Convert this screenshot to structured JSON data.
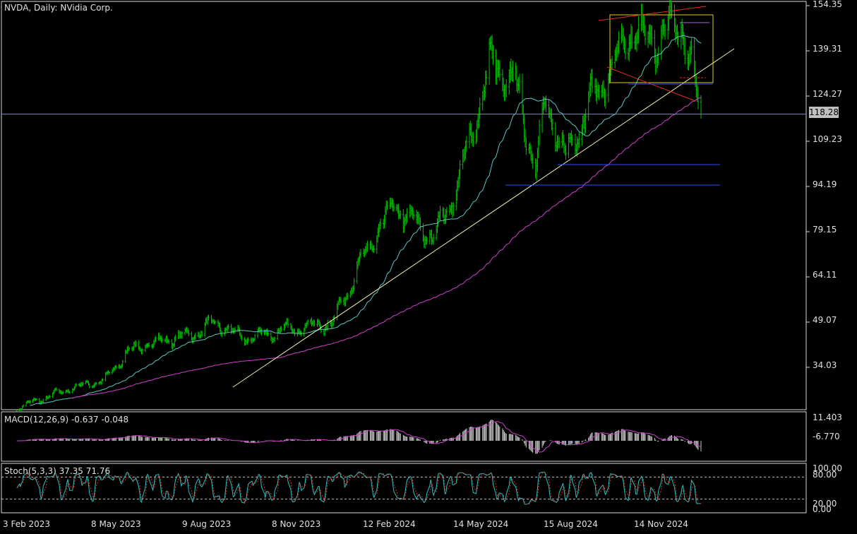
{
  "header": {
    "title": "NVDA, Daily:  NVidia Corp."
  },
  "colors": {
    "background": "#000000",
    "grid": "#ffffff",
    "candle": "#00c000",
    "ma_fast": "#58c8c0",
    "ma_slow": "#d040d0",
    "trend": "#f0f0b0",
    "box": "#e0d020",
    "wedge": "#e03020",
    "support": "#3050ff",
    "price_line": "#6a86b0",
    "macd_signal": "#d040d0",
    "stoch_main": "#30c0c0",
    "stoch_signal": "#d03030"
  },
  "price_axis": {
    "ticks": [
      "154.35",
      "139.31",
      "124.27",
      "109.23",
      "94.19",
      "79.15",
      "64.11",
      "49.07",
      "34.03"
    ],
    "current": "118.28"
  },
  "macd": {
    "label": "MACD(12,26,9) -0.637 -0.048",
    "ticks": [
      "11.403",
      "-6.770"
    ]
  },
  "stoch": {
    "label": "Stoch(5,3,3) 37.35 71.76",
    "ticks": [
      "100.00",
      "80.00",
      "20.00",
      "0.00"
    ]
  },
  "time_axis": {
    "ticks": [
      "3 Feb 2023",
      "8 May 2023",
      "9 Aug 2023",
      "8 Nov 2023",
      "12 Feb 2024",
      "14 May 2024",
      "15 Aug 2024",
      "14 Nov 2024"
    ]
  },
  "chart_data": {
    "type": "line",
    "title": "NVDA, Daily:  NVidia Corp.",
    "ylim": [
      24.0,
      157.0
    ],
    "x": [
      "2023-02-03",
      "2023-03-01",
      "2023-04-01",
      "2023-05-08",
      "2023-06-01",
      "2023-07-01",
      "2023-08-09",
      "2023-09-01",
      "2023-10-01",
      "2023-11-08",
      "2023-12-01",
      "2024-01-02",
      "2024-02-12",
      "2024-03-08",
      "2024-04-19",
      "2024-05-14",
      "2024-06-18",
      "2024-07-15",
      "2024-08-05",
      "2024-08-15",
      "2024-09-06",
      "2024-10-01",
      "2024-11-01",
      "2024-11-14",
      "2024-12-06",
      "2025-01-06",
      "2025-01-27"
    ],
    "series": [
      {
        "values": [
          20.5,
          23.5,
          27.0,
          30.0,
          39.5,
          42.5,
          45.0,
          49.0,
          43.5,
          46.0,
          47.5,
          48.5,
          75.0,
          88.0,
          77.0,
          94.0,
          135.0,
          128.0,
          100.0,
          122.0,
          104.0,
          122.0,
          137.0,
          146.0,
          142.0,
          149.0,
          118.28
        ]
      }
    ],
    "last_price": 118.28,
    "macd_ylim": [
      -8.5,
      13.0
    ],
    "stoch_ylim": [
      0,
      100
    ],
    "stoch_levels": [
      20,
      80
    ]
  }
}
